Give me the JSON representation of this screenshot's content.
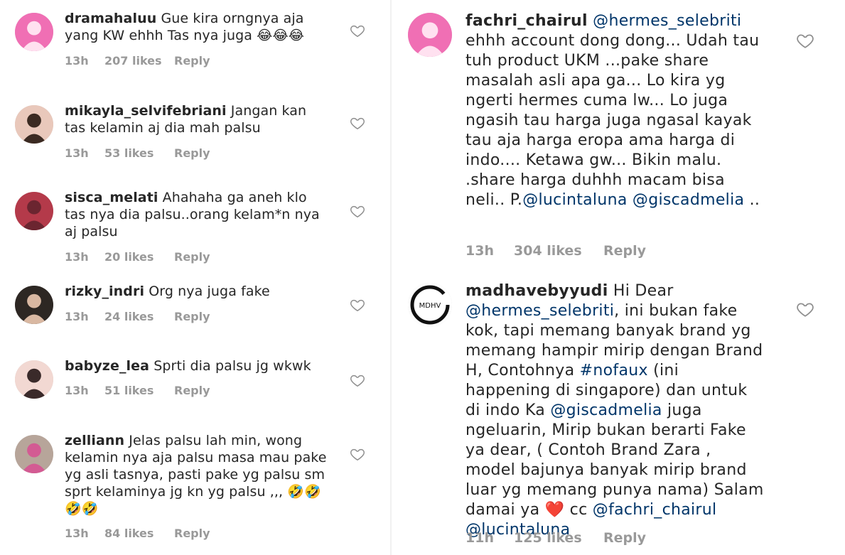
{
  "left_comments": [
    {
      "username": "dramahaluu",
      "segments": [
        {
          "t": "text",
          "v": " Gue kira orngnya aja yang KW ehhh Tas nya juga "
        },
        {
          "t": "emoji",
          "v": "😂😂😂"
        }
      ],
      "time": "13h",
      "likes": "207 likes",
      "reply": "Reply"
    },
    {
      "username": "mikayla_selvifebriani",
      "segments": [
        {
          "t": "text",
          "v": " Jangan kan tas kelamin aj dia mah palsu"
        }
      ],
      "time": "13h",
      "likes": "53 likes",
      "reply": "Reply"
    },
    {
      "username": "sisca_melati",
      "segments": [
        {
          "t": "text",
          "v": " Ahahaha ga aneh klo tas nya dia palsu..orang kelam*n nya aj  palsu"
        }
      ],
      "time": "13h",
      "likes": "20 likes",
      "reply": "Reply"
    },
    {
      "username": "rizky_indri",
      "segments": [
        {
          "t": "text",
          "v": " Org nya juga fake"
        }
      ],
      "time": "13h",
      "likes": "24 likes",
      "reply": "Reply"
    },
    {
      "username": "babyze_lea",
      "segments": [
        {
          "t": "text",
          "v": " Sprti dia palsu jg wkwk"
        }
      ],
      "time": "13h",
      "likes": "51 likes",
      "reply": "Reply"
    },
    {
      "username": "zelliann",
      "segments": [
        {
          "t": "text",
          "v": " Jelas palsu lah min, wong kelamin nya aja palsu masa mau pake yg asli tasnya, pasti pake yg palsu sm sprt kelaminya jg kn yg palsu ,,, "
        },
        {
          "t": "emoji",
          "v": "🤣🤣🤣🤣"
        }
      ],
      "time": "13h",
      "likes": "84 likes",
      "reply": "Reply"
    }
  ],
  "right_comments": [
    {
      "username": "fachri_chairul",
      "segments": [
        {
          "t": "mention",
          "v": " @hermes_selebriti"
        },
        {
          "t": "text",
          "v": " ehhh account dong dong... Udah tau tuh product UKM ...pake share masalah asli apa ga... Lo kira yg ngerti hermes cuma lw... Lo juga ngasih tau harga juga ngasal kayak tau aja harga eropa ama harga di indo.... Ketawa gw... Bikin malu. .share harga duhhh macam bisa neli.. P."
        },
        {
          "t": "mention",
          "v": "@lucintaluna"
        },
        {
          "t": "text",
          "v": " "
        },
        {
          "t": "mention",
          "v": "@giscadmelia"
        },
        {
          "t": "text",
          "v": " .."
        }
      ],
      "time": "13h",
      "likes": "304 likes",
      "reply": "Reply"
    },
    {
      "username": "madhavebyyudi",
      "avatar_text": "MDHV",
      "segments": [
        {
          "t": "text",
          "v": " Hi Dear "
        },
        {
          "t": "mention",
          "v": "@hermes_selebriti"
        },
        {
          "t": "text",
          "v": ", ini bukan fake kok, tapi memang banyak brand yg memang hampir mirip dengan Brand H, Contohnya "
        },
        {
          "t": "hashtag",
          "v": "#nofaux"
        },
        {
          "t": "text",
          "v": " (ini happening di singapore) dan untuk di indo Ka "
        },
        {
          "t": "mention",
          "v": "@giscadmelia"
        },
        {
          "t": "text",
          "v": " juga ngeluarin, Mirip bukan berarti Fake ya dear, ( Contoh Brand Zara , model bajunya banyak mirip brand luar yg memang punya nama) Salam damai ya "
        },
        {
          "t": "emoji",
          "v": "❤️"
        },
        {
          "t": "text",
          "v": " cc "
        },
        {
          "t": "mention",
          "v": "@fachri_chairul"
        },
        {
          "t": "text",
          "v": " "
        },
        {
          "t": "mention",
          "v": "@lucintaluna"
        }
      ],
      "time": "11h",
      "likes": "125 likes",
      "reply": "Reply"
    }
  ],
  "colors": {
    "username": "#262626",
    "mention": "#003569",
    "meta": "#999999",
    "heart_outline": "#8e8e8e"
  },
  "icons": {
    "like": "heart-outline-icon"
  }
}
